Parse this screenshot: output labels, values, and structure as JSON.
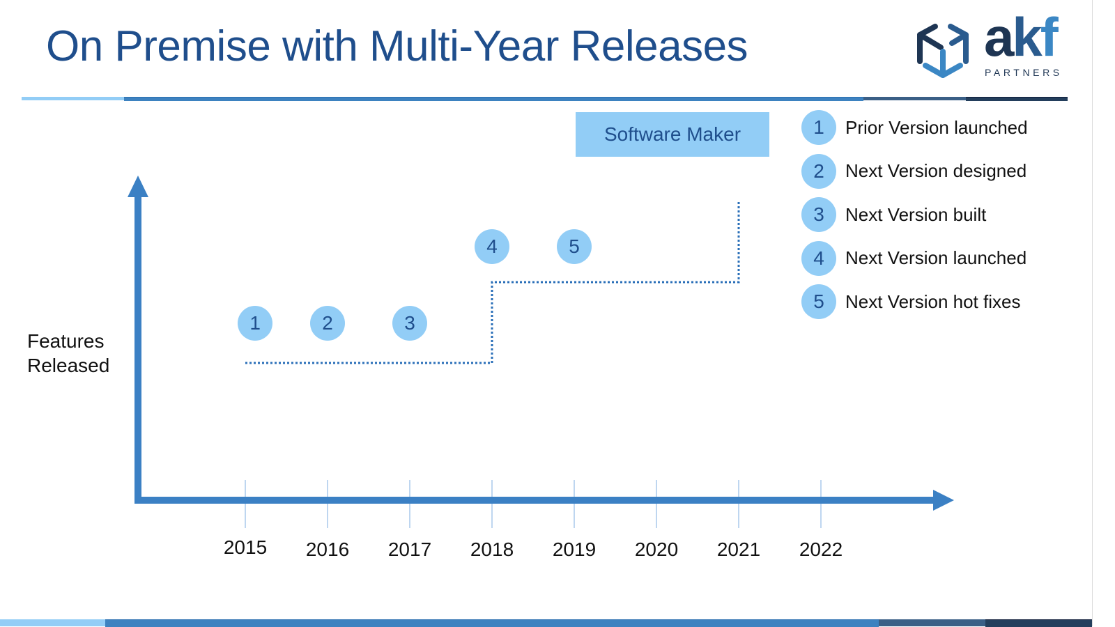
{
  "slide": {
    "title": "On Premise with Multi-Year Releases",
    "logo": {
      "mark": "akf",
      "mark_parts": [
        "a",
        "k",
        "f"
      ],
      "subtitle": "PARTNERS"
    },
    "category_box": "Software Maker",
    "y_axis_label_lines": [
      "Features",
      "Released"
    ],
    "x_axis_years": [
      "2015",
      "2016",
      "2017",
      "2018",
      "2019",
      "2020",
      "2021",
      "2022"
    ],
    "markers": [
      {
        "num": "1",
        "year": 2015.12,
        "level": "low"
      },
      {
        "num": "2",
        "year": 2016.0,
        "level": "low"
      },
      {
        "num": "3",
        "year": 2017.0,
        "level": "low"
      },
      {
        "num": "4",
        "year": 2018.0,
        "level": "high"
      },
      {
        "num": "5",
        "year": 2019.0,
        "level": "high"
      }
    ],
    "legend": [
      {
        "num": "1",
        "label": "Prior Version launched"
      },
      {
        "num": "2",
        "label": "Next Version designed"
      },
      {
        "num": "3",
        "label": "Next Version built"
      },
      {
        "num": "4",
        "label": "Next Version launched"
      },
      {
        "num": "5",
        "label": "Next Version hot fixes"
      }
    ],
    "release_step_line": {
      "description": "Dotted step line: flat level until 2018, steps up, flat level until 2021, then rises",
      "steps": [
        {
          "from_year": 2015,
          "to_year": 2018,
          "level": 1
        },
        {
          "from_year": 2018,
          "to_year": 2021,
          "level": 2
        },
        {
          "at_year": 2021,
          "rises_to_level": 3
        }
      ]
    },
    "colors": {
      "title": "#1f4e8c",
      "axis": "#3b80c4",
      "badge_fill": "#92cdf6",
      "badge_text": "#1f4e8c",
      "dotted_line": "#2a6fb8",
      "tick": "#a9c9ea",
      "rule_segments": [
        "#92cdf6",
        "#3d82c0",
        "#3a5f86",
        "#233e5c"
      ]
    }
  }
}
